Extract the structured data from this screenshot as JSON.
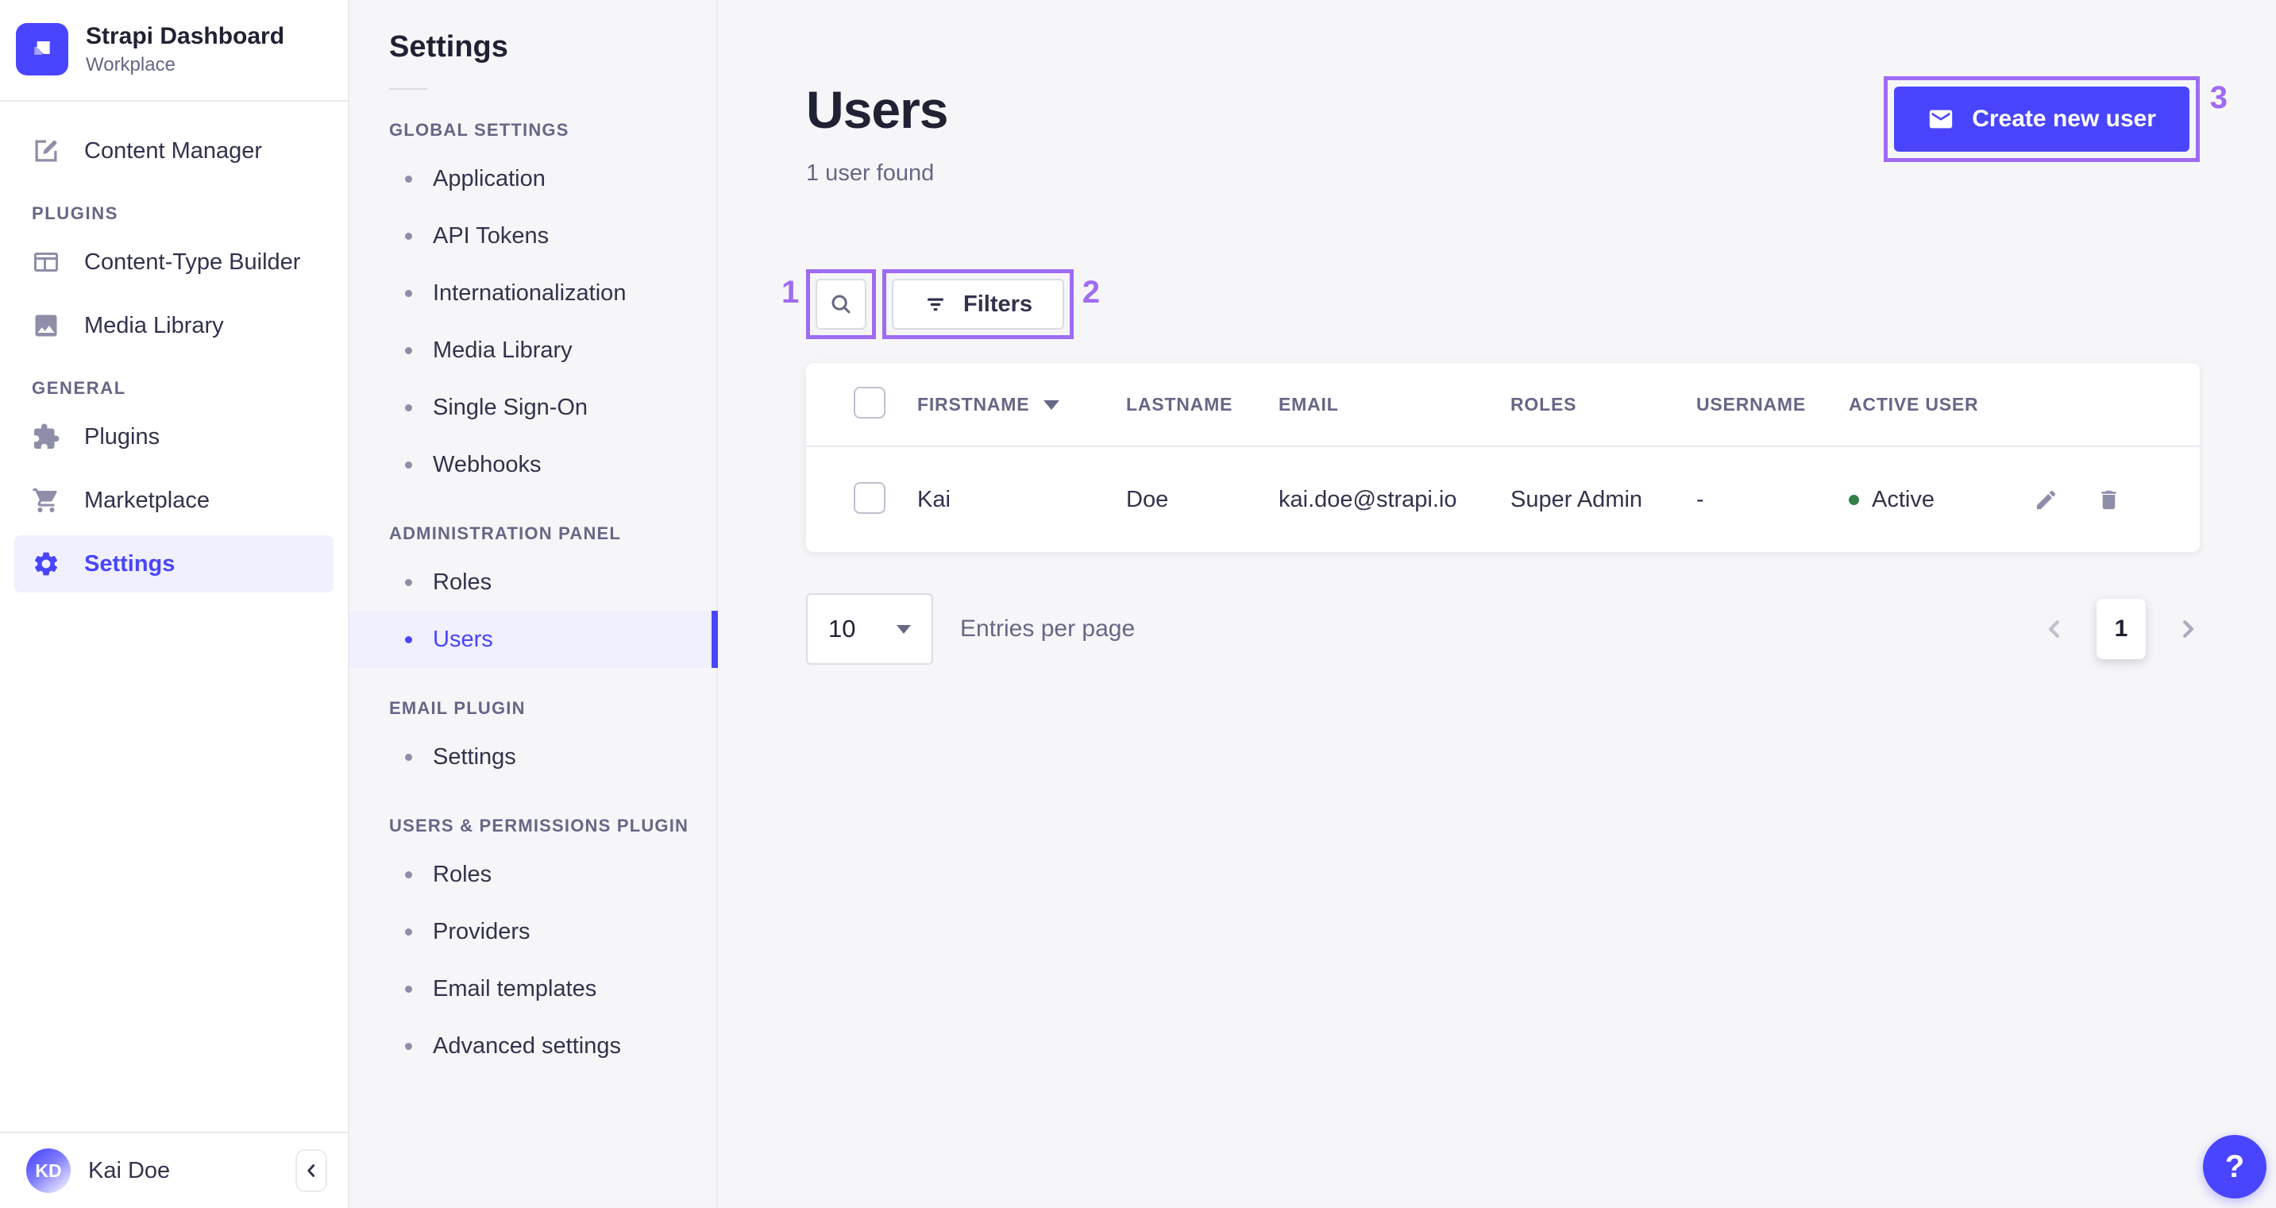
{
  "brand": {
    "title": "Strapi Dashboard",
    "workspace": "Workplace"
  },
  "nav": {
    "sections": {
      "plugins": "PLUGINS",
      "general": "GENERAL"
    },
    "items": [
      {
        "label": "Content Manager"
      },
      {
        "label": "Content-Type Builder"
      },
      {
        "label": "Media Library"
      },
      {
        "label": "Plugins"
      },
      {
        "label": "Marketplace"
      },
      {
        "label": "Settings"
      }
    ]
  },
  "subnav": {
    "title": "Settings",
    "groups": [
      {
        "label": "GLOBAL SETTINGS",
        "items": [
          "Application",
          "API Tokens",
          "Internationalization",
          "Media Library",
          "Single Sign-On",
          "Webhooks"
        ]
      },
      {
        "label": "ADMINISTRATION PANEL",
        "items": [
          "Roles",
          "Users"
        ]
      },
      {
        "label": "EMAIL PLUGIN",
        "items": [
          "Settings"
        ]
      },
      {
        "label": "USERS & PERMISSIONS PLUGIN",
        "items": [
          "Roles",
          "Providers",
          "Email templates",
          "Advanced settings"
        ]
      }
    ]
  },
  "page": {
    "title": "Users",
    "subtitle": "1 user found",
    "create_button": "Create new user",
    "filters_button": "Filters"
  },
  "annotations": {
    "search": "1",
    "filters": "2",
    "create": "3"
  },
  "table": {
    "headers": {
      "firstname": "FIRSTNAME",
      "lastname": "LASTNAME",
      "email": "EMAIL",
      "roles": "ROLES",
      "username": "USERNAME",
      "active_user": "ACTIVE USER"
    },
    "rows": [
      {
        "firstname": "Kai",
        "lastname": "Doe",
        "email": "kai.doe@strapi.io",
        "roles": "Super Admin",
        "username": "-",
        "active": "Active"
      }
    ]
  },
  "pagination": {
    "page_size": "10",
    "entries_label": "Entries per page",
    "current_page": "1"
  },
  "user": {
    "name": "Kai Doe",
    "initials": "KD"
  },
  "help": {
    "label": "?"
  },
  "colors": {
    "primary": "#4945FF",
    "primary_light": "#F0F0FF",
    "annotation": "#9F6BF2",
    "success_dot": "#328048"
  }
}
